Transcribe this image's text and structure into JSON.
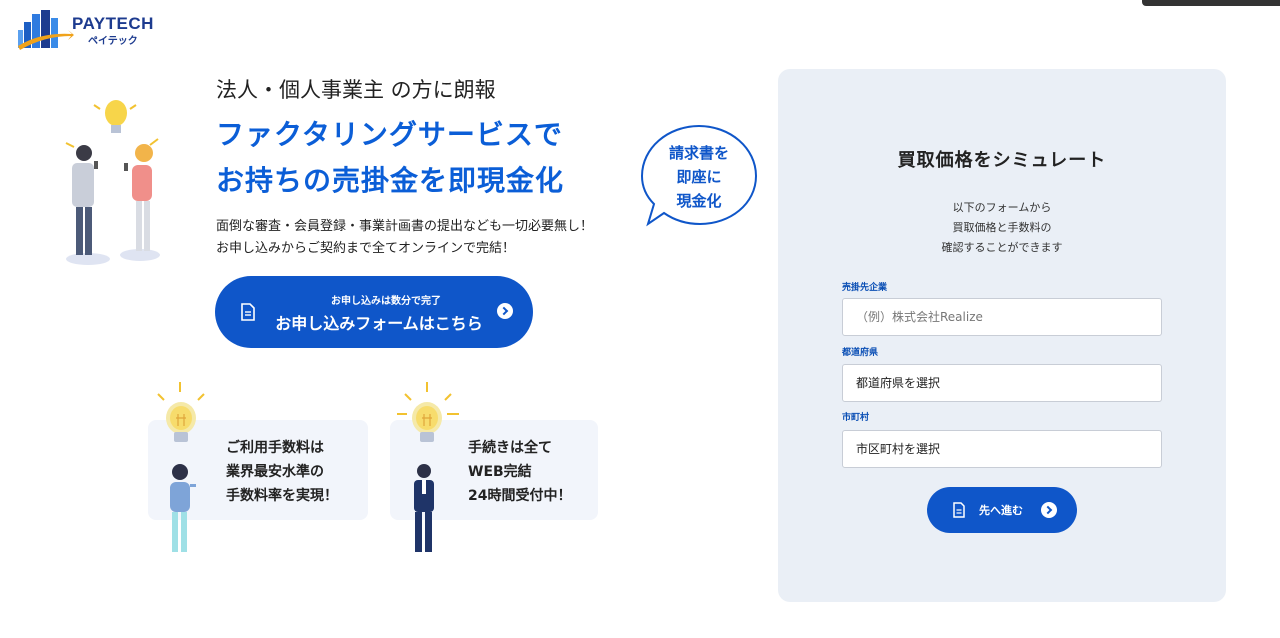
{
  "brand": {
    "name": "PAYTECH",
    "name_kana": "ペイテック"
  },
  "hero": {
    "subhead": "法人・個人事業主 の方に朗報",
    "headline_line1": "ファクタリングサービスで",
    "headline_line2": "お持ちの売掛金を即現金化",
    "desc_line1": "面倒な審査・会員登録・事業計画書の提出なども一切必要無し！",
    "desc_line2": "お申し込みからご契約まで全てオンラインで完結！",
    "cta_small": "お申し込みは数分で完了",
    "cta_big": "お申し込みフォームはこちら",
    "bubble_line1": "請求書を",
    "bubble_line2": "即座に",
    "bubble_line3": "現金化"
  },
  "features": [
    {
      "line1": "ご利用手数料は",
      "line2": "業界最安水準の",
      "line3": "手数料率を実現！"
    },
    {
      "line1": "手続きは全て",
      "line2": "WEB完結",
      "line3": "24時間受付中！"
    }
  ],
  "simulator": {
    "title": "買取価格をシミュレート",
    "desc_line1": "以下のフォームから",
    "desc_line2": "買取価格と手数料の",
    "desc_line3": "確認することができます",
    "company_label": "売掛先企業",
    "company_placeholder": "（例）株式会社Realize",
    "prefecture_label": "都道府県",
    "prefecture_value": "都道府県を選択",
    "city_label": "市町村",
    "city_value": "市区町村を選択",
    "next_button": "先へ進む"
  },
  "colors": {
    "primary": "#0f56c9",
    "headline": "#0b5ed7",
    "panel_bg": "#eaeff6",
    "feature_bg": "#f2f5fb"
  },
  "icons": [
    "building-logo-icon",
    "document-icon",
    "arrow-circle-icon",
    "lightbulb-icon"
  ]
}
